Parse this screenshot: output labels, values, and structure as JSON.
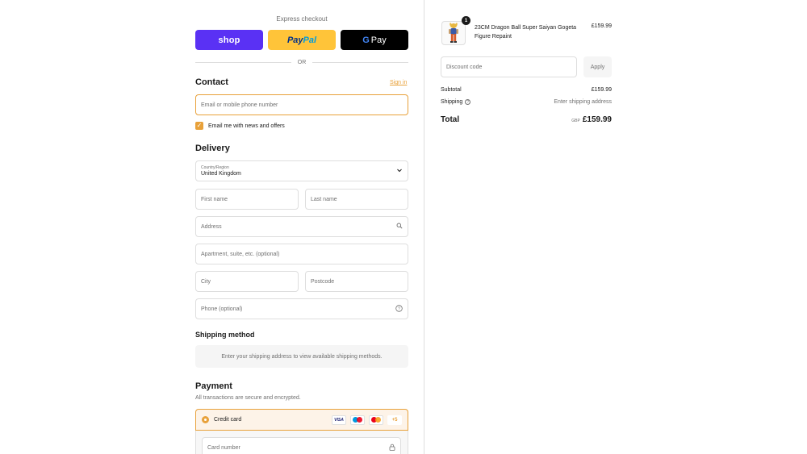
{
  "express": {
    "title": "Express checkout",
    "shop_label": "shop",
    "paypal_pay": "Pay",
    "paypal_pal": "Pal",
    "gpay_g": "G",
    "gpay_label": "Pay",
    "or_label": "OR"
  },
  "contact": {
    "heading": "Contact",
    "sign_in": "Sign in",
    "email_placeholder": "Email or mobile phone number",
    "news_checkbox_label": "Email me with news and offers",
    "news_checked": true
  },
  "delivery": {
    "heading": "Delivery",
    "country_label": "Country/Region",
    "country_value": "United Kingdom",
    "first_name_placeholder": "First name",
    "last_name_placeholder": "Last name",
    "address_placeholder": "Address",
    "apartment_placeholder": "Apartment, suite, etc. (optional)",
    "city_placeholder": "City",
    "postcode_placeholder": "Postcode",
    "phone_placeholder": "Phone (optional)"
  },
  "shipping_method": {
    "heading": "Shipping method",
    "info": "Enter your shipping address to view available shipping methods."
  },
  "payment": {
    "heading": "Payment",
    "subtitle": "All transactions are secure and encrypted.",
    "method_label": "Credit card",
    "cards": [
      "VISA",
      "maestro",
      "mastercard"
    ],
    "more_cards": "+5",
    "card_number_placeholder": "Card number"
  },
  "order": {
    "item": {
      "quantity": "1",
      "name": "23CM Dragon Ball Super Saiyan Gogeta Figure Repaint",
      "price": "£159.99"
    },
    "discount_placeholder": "Discount code",
    "apply_label": "Apply",
    "subtotal_label": "Subtotal",
    "subtotal_value": "£159.99",
    "shipping_label": "Shipping",
    "shipping_value": "Enter shipping address",
    "total_label": "Total",
    "currency": "GBP",
    "total_value": "£159.99"
  },
  "colors": {
    "accent": "#e8a13a",
    "shop_pay": "#5a31f4",
    "paypal": "#ffc439",
    "gpay": "#000000"
  }
}
